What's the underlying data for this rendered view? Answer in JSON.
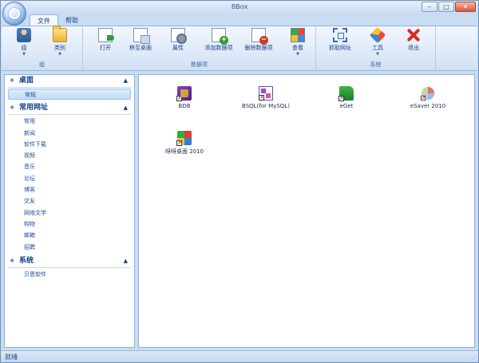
{
  "window": {
    "title": "BBox"
  },
  "menu": {
    "tabs": [
      "文件",
      "帮助"
    ]
  },
  "ribbon": {
    "groups": [
      {
        "label": "组",
        "buttons": [
          "组",
          "类别"
        ]
      },
      {
        "label": "数据项",
        "buttons": [
          "打开",
          "移至桌面",
          "属性",
          "添加数据项",
          "删除数据项",
          "查看"
        ]
      },
      {
        "label": "系统",
        "buttons": [
          "抓取网址",
          "工具",
          "退出"
        ]
      }
    ]
  },
  "sidebar": {
    "sections": [
      {
        "title": "桌面",
        "items": [
          "常规"
        ]
      },
      {
        "title": "常用网址",
        "items": [
          "常用",
          "新闻",
          "软件下载",
          "视频",
          "音乐",
          "论坛",
          "博客",
          "交友",
          "网络文学",
          "购物",
          "邮箱",
          "招聘"
        ]
      },
      {
        "title": "系统",
        "items": [
          "贝恩软件"
        ]
      }
    ]
  },
  "content": {
    "items": [
      {
        "name": "BDB",
        "icon": "bdb-app-icon"
      },
      {
        "name": "BSQL(for MySQL)",
        "icon": "bsql-app-icon"
      },
      {
        "name": "eGet",
        "icon": "eget-app-icon"
      },
      {
        "name": "eSaver 2010",
        "icon": "esaver-app-icon"
      },
      {
        "name": "呀呀桌面 2010",
        "icon": "yaya-desktop-app-icon"
      }
    ]
  },
  "status": {
    "text": "就绪"
  }
}
